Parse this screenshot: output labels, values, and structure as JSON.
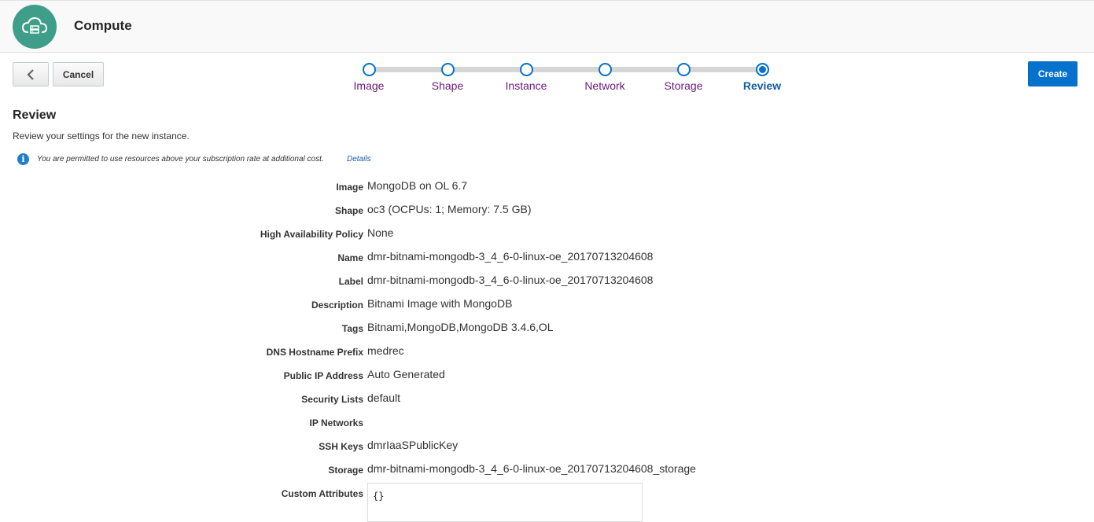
{
  "header": {
    "title": "Compute",
    "icon": "cloud-server-icon"
  },
  "toolbar": {
    "back_icon": "chevron-left-icon",
    "cancel_label": "Cancel",
    "create_label": "Create"
  },
  "train": {
    "steps": [
      {
        "label": "Image",
        "state": "visited"
      },
      {
        "label": "Shape",
        "state": "visited"
      },
      {
        "label": "Instance",
        "state": "visited"
      },
      {
        "label": "Network",
        "state": "visited"
      },
      {
        "label": "Storage",
        "state": "visited"
      },
      {
        "label": "Review",
        "state": "current"
      }
    ]
  },
  "review": {
    "title": "Review",
    "subtitle": "Review your settings for the new instance.",
    "info_text": "You are permitted to use resources above your subscription rate at additional cost.",
    "info_link": "Details",
    "fields": [
      {
        "key": "Image",
        "value": "MongoDB on OL 6.7"
      },
      {
        "key": "Shape",
        "value": "oc3 (OCPUs: 1; Memory: 7.5 GB)"
      },
      {
        "key": "High Availability Policy",
        "value": "None"
      },
      {
        "key": "Name",
        "value": "dmr-bitnami-mongodb-3_4_6-0-linux-oe_20170713204608"
      },
      {
        "key": "Label",
        "value": "dmr-bitnami-mongodb-3_4_6-0-linux-oe_20170713204608"
      },
      {
        "key": "Description",
        "value": "Bitnami Image with MongoDB"
      },
      {
        "key": "Tags",
        "value": "Bitnami,MongoDB,MongoDB 3.4.6,OL"
      },
      {
        "key": "DNS Hostname Prefix",
        "value": "medrec"
      },
      {
        "key": "Public IP Address",
        "value": "Auto Generated"
      },
      {
        "key": "Security Lists",
        "value": "default"
      },
      {
        "key": "IP Networks",
        "value": ""
      },
      {
        "key": "SSH Keys",
        "value": "dmrIaaSPublicKey"
      },
      {
        "key": "Storage",
        "value": "dmr-bitnami-mongodb-3_4_6-0-linux-oe_20170713204608_storage"
      }
    ],
    "custom_attributes_label": "Custom Attributes",
    "custom_attributes_value": "{}"
  },
  "colors": {
    "accent": "#0572ce",
    "brand": "#3f9e89",
    "visited_link": "#6c1a7d"
  }
}
